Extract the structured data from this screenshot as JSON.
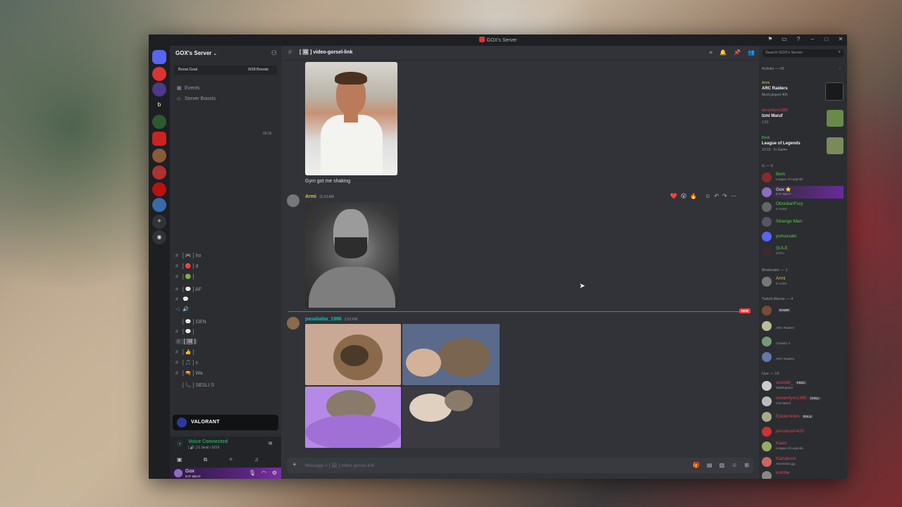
{
  "window": {
    "title": "GOX's Server"
  },
  "server": {
    "name": "GOX's Server",
    "boost_label": "Boost Goal",
    "boost_count": "0/28 Boosts"
  },
  "sidebar": {
    "events": "Events",
    "server_boosts": "Server Boosts",
    "time": "09:16",
    "channels": [
      {
        "label": "[ 🎮 ] ho"
      },
      {
        "label": "[ 🔴 ] d"
      },
      {
        "label": "[ 🟢 ]"
      },
      {
        "label": "[ 💬 ] AF"
      },
      {
        "label": "💬"
      },
      {
        "label": "🔊"
      },
      {
        "label": "[ 💬 ] GEN"
      },
      {
        "label": "[ 💬 ]"
      },
      {
        "label": "[ 🖼 ]"
      },
      {
        "label": "[ 👍 ]"
      },
      {
        "label": "[ 🎵 ] s"
      },
      {
        "label": "[ 🔫 ] Wa"
      },
      {
        "label": "[ 📞 ] SESLI S"
      }
    ],
    "valorant": "VALORANT",
    "voice_status": "Voice Connected",
    "voice_sub": "[ 🔊 ] G Sesli / GOX",
    "user": {
      "name": "Gox",
      "status": "EAT MEAT"
    }
  },
  "channel": {
    "name": "video-gorsel-link",
    "prefix": "[ 🖼 ]"
  },
  "messages": {
    "caption1": "Gym got me shaking",
    "msg2_user": "Armi",
    "msg2_time": "11:23 AM",
    "msg3_user": "pasababa_1986",
    "msg3_time": "2:52 PM",
    "new_tag": "NEW",
    "reactions": [
      "❤️",
      "😮",
      "🔥"
    ]
  },
  "composer": {
    "placeholder": "Message # [ 🖼 ] video-gorsel-link"
  },
  "members_panel": {
    "search_placeholder": "Search GOX's Server",
    "activity_header": "Activity — 41",
    "activity": [
      {
        "user": "Armi",
        "title": "ARC Raiders",
        "sub": "Most played 40h",
        "thumb": "#1a1a1a",
        "user_color": "#e6c44c"
      },
      {
        "user": "dreamfyre1385",
        "title": "Izmi Maruf",
        "sub": "1:51",
        "thumb": "#6a8a4a",
        "user_color": "#e0414a"
      },
      {
        "user": "Berk",
        "title": "League of Legends",
        "sub": "10:15 · In Game",
        "thumb": "#7a8a5a",
        "user_color": "#57c94a"
      }
    ],
    "groups": [
      {
        "header": "G — 6",
        "members": [
          {
            "name": "Berk",
            "status": "League of Legends",
            "color": "#57c94a",
            "av": "#8a2b2b"
          },
          {
            "name": "Gox ⭐",
            "status": "EAT MEAT",
            "color": "#f2f3f5",
            "av": "#8a6fbf"
          },
          {
            "name": "ObsidianFury",
            "status": "In voice",
            "color": "#57c94a",
            "av": "#666"
          },
          {
            "name": "Strange Man",
            "status": "",
            "color": "#57c94a",
            "av": "#556"
          },
          {
            "name": "yunussaki",
            "status": "",
            "color": "#57c94a",
            "av": "#5865f2"
          },
          {
            "name": "ŞULE",
            "status": "STFU",
            "color": "#57c94a",
            "av": "#3c2b2b"
          }
        ]
      },
      {
        "header": "Moderator — 1",
        "members": [
          {
            "name": "Armi",
            "status": "In voice",
            "color": "#e6c44c",
            "av": "#777"
          }
        ]
      },
      {
        "header": "Twitch Abone — 4",
        "members": [
          {
            "name": "",
            "status": "",
            "tag": "RAWR",
            "color": "#9b59f0",
            "av": "#7a4a3a"
          },
          {
            "name": "",
            "status": "ARC Raiders",
            "color": "#9b59f0",
            "av": "#bb9"
          },
          {
            "name": "",
            "status": "Chivalry 2",
            "color": "#9b59f0",
            "av": "#797"
          },
          {
            "name": "",
            "status": "ARC Raiders",
            "color": "#9b59f0",
            "av": "#6677aa"
          }
        ]
      },
      {
        "header": "Üye — 13",
        "members": [
          {
            "name": "arastiel_",
            "status": "StarRupture",
            "tag": "FSSC",
            "color": "#e0414a",
            "av": "#ccc"
          },
          {
            "name": "dreamfyre1385",
            "status": "Izmi Maruf",
            "tag": "CHILL",
            "color": "#e0414a",
            "av": "#bbb"
          },
          {
            "name": "Epidemides",
            "status": "",
            "tag": "RVLS",
            "color": "#e0414a",
            "av": "#aa8"
          },
          {
            "name": "jesuskush420",
            "status": "",
            "color": "#e0414a",
            "av": "#c33"
          },
          {
            "name": "Kaan",
            "status": "League of Legends",
            "color": "#e0414a",
            "av": "#9a6"
          },
          {
            "name": "Kazukomi",
            "status": "Ascension.gg",
            "color": "#e0414a",
            "av": "#c66"
          },
          {
            "name": "kombe",
            "status": "",
            "color": "#e0414a",
            "av": "#888"
          }
        ]
      }
    ]
  },
  "colors": {
    "accent": "#5865f2",
    "online": "#23a55a",
    "new_bar": "#f23f43",
    "armi_name": "#e6c44c",
    "pasa_name": "#00c6b3"
  }
}
